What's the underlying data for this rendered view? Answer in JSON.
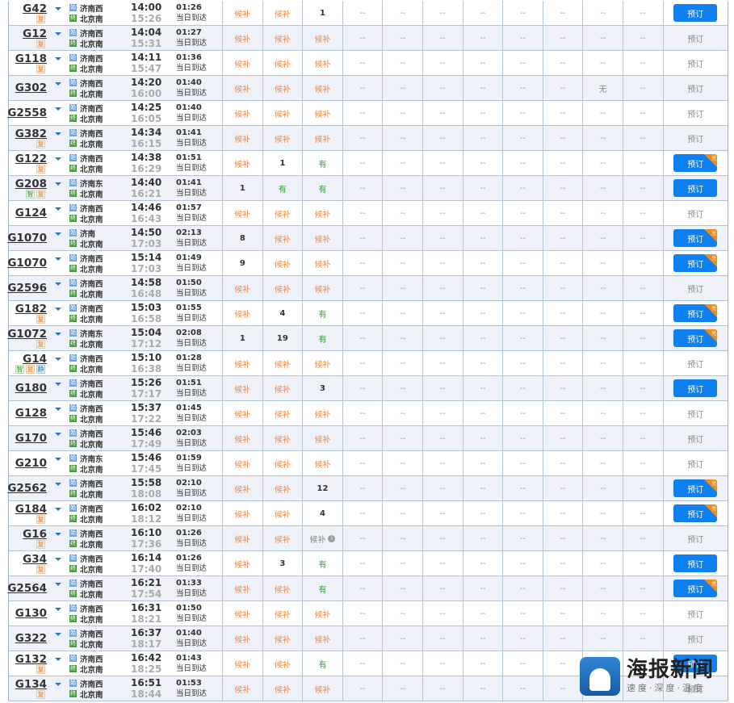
{
  "colors": {
    "book_button": "#0f80ef",
    "waitlist": "#ef8a4a",
    "available": "#3b9a3b",
    "alt_row": "#eef1f8",
    "hot_corner": "#f08c1e"
  },
  "labels": {
    "book": "预订",
    "same_day": "当日到达",
    "hot_corner": "兑",
    "info_icon": "i",
    "dest": "北京南",
    "from_icon": "始",
    "to_icon": "终"
  },
  "watermark": {
    "title": "海报新闻",
    "slogan": "速度·深度·温度"
  },
  "trains": [
    {
      "no": "G42",
      "badges": [
        "复"
      ],
      "from": "济南西",
      "dep": "14:00",
      "arr": "15:26",
      "dur": "01:26",
      "seats": [
        "候补",
        "候补",
        "1",
        "--",
        "--",
        "--",
        "--",
        "--",
        "--",
        "--",
        "--"
      ],
      "book": true,
      "hot": false
    },
    {
      "no": "G12",
      "badges": [
        "复"
      ],
      "from": "济南西",
      "dep": "14:04",
      "arr": "15:31",
      "dur": "01:27",
      "seats": [
        "候补",
        "候补",
        "候补",
        "--",
        "--",
        "--",
        "--",
        "--",
        "--",
        "--",
        "--"
      ],
      "book": false,
      "hot": false
    },
    {
      "no": "G118",
      "badges": [
        "复"
      ],
      "from": "济南西",
      "dep": "14:11",
      "arr": "15:47",
      "dur": "01:36",
      "seats": [
        "候补",
        "候补",
        "候补",
        "--",
        "--",
        "--",
        "--",
        "--",
        "--",
        "--",
        "--"
      ],
      "book": false,
      "hot": false
    },
    {
      "no": "G302",
      "badges": [],
      "from": "济南西",
      "dep": "14:20",
      "arr": "16:00",
      "dur": "01:40",
      "seats": [
        "候补",
        "候补",
        "候补",
        "--",
        "--",
        "--",
        "--",
        "--",
        "--",
        "无",
        "--"
      ],
      "book": false,
      "hot": false
    },
    {
      "no": "G2558",
      "badges": [],
      "from": "济南西",
      "dep": "14:25",
      "arr": "16:05",
      "dur": "01:40",
      "seats": [
        "候补",
        "候补",
        "候补",
        "--",
        "--",
        "--",
        "--",
        "--",
        "--",
        "--",
        "--"
      ],
      "book": false,
      "hot": false
    },
    {
      "no": "G382",
      "badges": [
        "复"
      ],
      "from": "济南西",
      "dep": "14:34",
      "arr": "16:15",
      "dur": "01:41",
      "seats": [
        "候补",
        "候补",
        "候补",
        "--",
        "--",
        "--",
        "--",
        "--",
        "--",
        "--",
        "--"
      ],
      "book": false,
      "hot": false
    },
    {
      "no": "G122",
      "badges": [
        "复"
      ],
      "from": "济南西",
      "dep": "14:38",
      "arr": "16:29",
      "dur": "01:51",
      "seats": [
        "候补",
        "1",
        "有",
        "--",
        "--",
        "--",
        "--",
        "--",
        "--",
        "--",
        "--"
      ],
      "book": true,
      "hot": true
    },
    {
      "no": "G208",
      "badges": [
        "智",
        "复"
      ],
      "from": "济南东",
      "dep": "14:40",
      "arr": "16:21",
      "dur": "01:41",
      "seats": [
        "1",
        "有",
        "有",
        "--",
        "--",
        "--",
        "--",
        "--",
        "--",
        "--",
        "--"
      ],
      "book": true,
      "hot": false
    },
    {
      "no": "G124",
      "badges": [],
      "from": "济南西",
      "dep": "14:46",
      "arr": "16:43",
      "dur": "01:57",
      "seats": [
        "候补",
        "候补",
        "候补",
        "--",
        "--",
        "--",
        "--",
        "--",
        "--",
        "--",
        "--"
      ],
      "book": false,
      "hot": false
    },
    {
      "no": "G1070",
      "badges": [],
      "from": "济南",
      "dep": "14:50",
      "arr": "17:03",
      "dur": "02:13",
      "seats": [
        "8",
        "候补",
        "候补",
        "--",
        "--",
        "--",
        "--",
        "--",
        "--",
        "--",
        "--"
      ],
      "book": true,
      "hot": true
    },
    {
      "no": "G1070",
      "badges": [],
      "from": "济南西",
      "dep": "15:14",
      "arr": "17:03",
      "dur": "01:49",
      "seats": [
        "9",
        "候补",
        "候补",
        "--",
        "--",
        "--",
        "--",
        "--",
        "--",
        "--",
        "--"
      ],
      "book": true,
      "hot": true
    },
    {
      "no": "G2596",
      "badges": [],
      "from": "济南西",
      "dep": "14:58",
      "arr": "16:48",
      "dur": "01:50",
      "seats": [
        "候补",
        "候补",
        "候补",
        "--",
        "--",
        "--",
        "--",
        "--",
        "--",
        "--",
        "--"
      ],
      "book": false,
      "hot": false
    },
    {
      "no": "G182",
      "badges": [
        "复"
      ],
      "from": "济南西",
      "dep": "15:03",
      "arr": "16:58",
      "dur": "01:55",
      "seats": [
        "候补",
        "4",
        "有",
        "--",
        "--",
        "--",
        "--",
        "--",
        "--",
        "--",
        "--"
      ],
      "book": true,
      "hot": true
    },
    {
      "no": "G1072",
      "badges": [
        "复"
      ],
      "from": "济南东",
      "dep": "15:04",
      "arr": "17:12",
      "dur": "02:08",
      "seats": [
        "1",
        "19",
        "有",
        "--",
        "--",
        "--",
        "--",
        "--",
        "--",
        "--",
        "--"
      ],
      "book": true,
      "hot": true
    },
    {
      "no": "G14",
      "badges": [
        "智",
        "复",
        "静"
      ],
      "from": "济南西",
      "dep": "15:10",
      "arr": "16:38",
      "dur": "01:28",
      "seats": [
        "候补",
        "候补",
        "候补",
        "--",
        "--",
        "--",
        "--",
        "--",
        "--",
        "--",
        "--"
      ],
      "book": false,
      "hot": false
    },
    {
      "no": "G180",
      "badges": [],
      "from": "济南西",
      "dep": "15:26",
      "arr": "17:17",
      "dur": "01:51",
      "seats": [
        "候补",
        "候补",
        "3",
        "--",
        "--",
        "--",
        "--",
        "--",
        "--",
        "--",
        "--"
      ],
      "book": true,
      "hot": false
    },
    {
      "no": "G128",
      "badges": [],
      "from": "济南西",
      "dep": "15:37",
      "arr": "17:22",
      "dur": "01:45",
      "seats": [
        "候补",
        "候补",
        "候补",
        "--",
        "--",
        "--",
        "--",
        "--",
        "--",
        "--",
        "--"
      ],
      "book": false,
      "hot": false
    },
    {
      "no": "G170",
      "badges": [],
      "from": "济南西",
      "dep": "15:46",
      "arr": "17:49",
      "dur": "02:03",
      "seats": [
        "候补",
        "候补",
        "候补",
        "--",
        "--",
        "--",
        "--",
        "--",
        "--",
        "--",
        "--"
      ],
      "book": false,
      "hot": false
    },
    {
      "no": "G210",
      "badges": [],
      "from": "济南东",
      "dep": "15:46",
      "arr": "17:45",
      "dur": "01:59",
      "seats": [
        "候补",
        "候补",
        "候补",
        "--",
        "--",
        "--",
        "--",
        "--",
        "--",
        "--",
        "--"
      ],
      "book": false,
      "hot": false
    },
    {
      "no": "G2562",
      "badges": [],
      "from": "济南西",
      "dep": "15:58",
      "arr": "18:08",
      "dur": "02:10",
      "seats": [
        "候补",
        "候补",
        "12",
        "--",
        "--",
        "--",
        "--",
        "--",
        "--",
        "--",
        "--"
      ],
      "book": true,
      "hot": true
    },
    {
      "no": "G184",
      "badges": [
        "复"
      ],
      "from": "济南西",
      "dep": "16:02",
      "arr": "18:12",
      "dur": "02:10",
      "seats": [
        "候补",
        "候补",
        "4",
        "--",
        "--",
        "--",
        "--",
        "--",
        "--",
        "--",
        "--"
      ],
      "book": true,
      "hot": true
    },
    {
      "no": "G16",
      "badges": [
        "复"
      ],
      "from": "济南西",
      "dep": "16:10",
      "arr": "17:36",
      "dur": "01:26",
      "seats": [
        "候补",
        "候补",
        "候补",
        "--",
        "--",
        "--",
        "--",
        "--",
        "--",
        "--",
        "--"
      ],
      "disabled_seat": 2,
      "book": false,
      "hot": false
    },
    {
      "no": "G34",
      "badges": [
        "复"
      ],
      "from": "济南西",
      "dep": "16:14",
      "arr": "17:40",
      "dur": "01:26",
      "seats": [
        "候补",
        "3",
        "有",
        "--",
        "--",
        "--",
        "--",
        "--",
        "--",
        "--",
        "--"
      ],
      "book": true,
      "hot": false
    },
    {
      "no": "G2564",
      "badges": [],
      "from": "济南西",
      "dep": "16:21",
      "arr": "17:54",
      "dur": "01:33",
      "seats": [
        "候补",
        "候补",
        "有",
        "--",
        "--",
        "--",
        "--",
        "--",
        "--",
        "--",
        "--"
      ],
      "book": true,
      "hot": true
    },
    {
      "no": "G130",
      "badges": [],
      "from": "济南西",
      "dep": "16:31",
      "arr": "18:21",
      "dur": "01:50",
      "seats": [
        "候补",
        "候补",
        "候补",
        "--",
        "--",
        "--",
        "--",
        "--",
        "--",
        "--",
        "--"
      ],
      "book": false,
      "hot": false
    },
    {
      "no": "G322",
      "badges": [],
      "from": "济南西",
      "dep": "16:37",
      "arr": "18:17",
      "dur": "01:40",
      "seats": [
        "候补",
        "候补",
        "候补",
        "--",
        "--",
        "--",
        "--",
        "--",
        "--",
        "--",
        "--"
      ],
      "book": false,
      "hot": false
    },
    {
      "no": "G132",
      "badges": [
        "复"
      ],
      "from": "济南西",
      "dep": "16:42",
      "arr": "18:25",
      "dur": "01:43",
      "seats": [
        "候补",
        "候补",
        "有",
        "--",
        "--",
        "--",
        "--",
        "--",
        "--",
        "--",
        "--"
      ],
      "book": true,
      "hot": false
    },
    {
      "no": "G134",
      "badges": [
        "复"
      ],
      "from": "济南西",
      "dep": "16:51",
      "arr": "18:44",
      "dur": "01:53",
      "seats": [
        "候补",
        "候补",
        "候补",
        "--",
        "--",
        "--",
        "--",
        "--",
        "--",
        "--",
        "--"
      ],
      "book": false,
      "hot": false
    }
  ]
}
